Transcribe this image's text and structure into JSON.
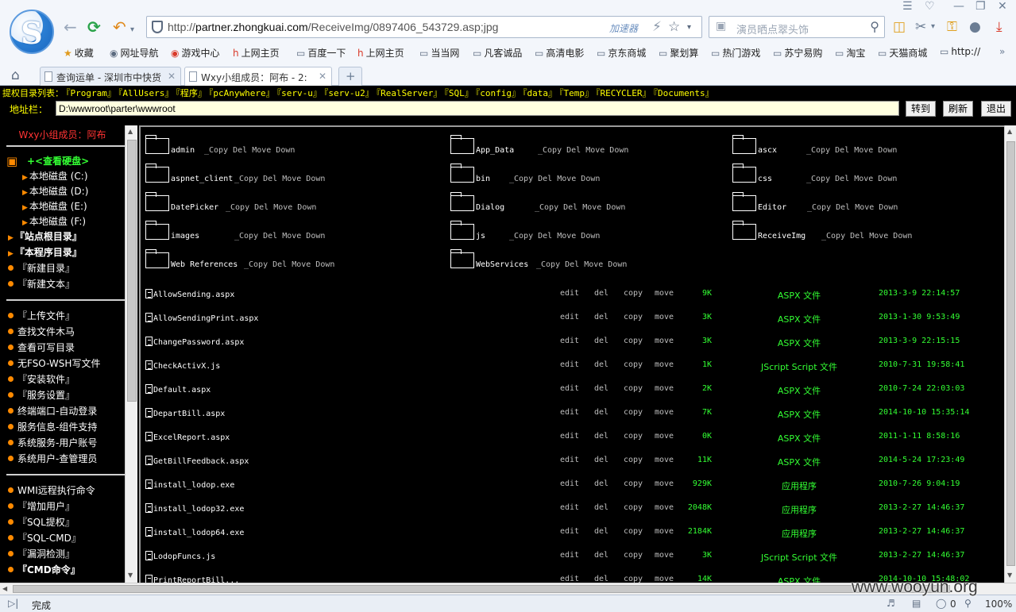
{
  "browser": {
    "logo_letter": "S",
    "url_domain": "partner.zhongkuai.com",
    "url_prefix": "http://",
    "url_path": "/ReceiveImg/0897406_543729.asp;jpg",
    "accelerator_label": "加速器",
    "search_placeholder": "演员晒点翠头饰",
    "favorites": [
      {
        "label": "收藏",
        "icon": "star-icon"
      },
      {
        "label": "网址导航",
        "icon": "globe-icon"
      },
      {
        "label": "游戏中心",
        "icon": "game-icon"
      },
      {
        "label": "上网主页",
        "icon": "hao-icon"
      },
      {
        "label": "百度一下",
        "icon": "page-icon"
      },
      {
        "label": "上网主页",
        "icon": "hao-icon"
      },
      {
        "label": "当当网",
        "icon": "page-icon"
      },
      {
        "label": "凡客诚品",
        "icon": "page-icon"
      },
      {
        "label": "高清电影",
        "icon": "page-icon"
      },
      {
        "label": "京东商城",
        "icon": "page-icon"
      },
      {
        "label": "聚划算",
        "icon": "page-icon"
      },
      {
        "label": "热门游戏",
        "icon": "page-icon"
      },
      {
        "label": "苏宁易购",
        "icon": "page-icon"
      },
      {
        "label": "淘宝",
        "icon": "page-icon"
      },
      {
        "label": "天猫商城",
        "icon": "page-icon"
      },
      {
        "label": "http://",
        "icon": "page-icon"
      }
    ],
    "tabs": [
      {
        "label": "查询运单 - 深圳市中快货",
        "active": false
      },
      {
        "label": "Wxy小组成员：阿布 - 2:",
        "active": true
      }
    ],
    "status_text": "完成",
    "blocked_count": "0",
    "zoom": "100%"
  },
  "shell": {
    "dir_list_label": "提权目录列表：",
    "dir_list": [
      "『Program』",
      "『AllUsers』",
      "『程序』",
      "『pcAnywhere』",
      "『serv-u』",
      "『serv-u2』",
      "『RealServer』",
      "『SQL』",
      "『config』",
      "『data』",
      "『Temp』",
      "『RECYCLER』",
      "『Documents』"
    ],
    "address_label": "地址栏：",
    "address_value": "D:\\wwwroot\\parter\\wwwroot",
    "goto_label": "转到",
    "refresh_label": "刷新",
    "exit_label": "退出"
  },
  "sidebar": {
    "title": "Wxy小组成员：阿布",
    "view_disks": "+<查看硬盘>",
    "disks": [
      "本地磁盘 (C:)",
      "本地磁盘 (D:)",
      "本地磁盘 (E:)",
      "本地磁盘 (F:)"
    ],
    "group1": [
      "『站点根目录』",
      "『本程序目录』",
      "『新建目录』",
      "『新建文本』"
    ],
    "group2": [
      "『上传文件』",
      "查找文件木马",
      "查看可写目录",
      "无FSO-WSH写文件",
      "『安装软件』",
      "『服务设置』",
      "终端端口-自动登录",
      "服务信息-组件支持",
      "系统服务-用户账号",
      "系统用户-查管理员"
    ],
    "group3": [
      "WMI远程执行命令",
      "『增加用户』",
      "『SQL提权』",
      "『SQL-CMD』",
      "『漏洞检测』",
      "『CMD命令』"
    ]
  },
  "folders": [
    {
      "name": "admin",
      "actions": "_Copy Del Move Down"
    },
    {
      "name": "App_Data",
      "actions": "_Copy Del Move Down"
    },
    {
      "name": "ascx",
      "actions": "_Copy Del Move Down"
    },
    {
      "name": "aspnet_client",
      "actions": "_Copy Del Move Down"
    },
    {
      "name": "bin",
      "actions": "_Copy Del Move Down"
    },
    {
      "name": "css",
      "actions": "_Copy Del Move Down"
    },
    {
      "name": "DatePicker",
      "actions": "_Copy Del Move Down"
    },
    {
      "name": "Dialog",
      "actions": "_Copy Del Move Down"
    },
    {
      "name": "Editor",
      "actions": "_Copy Del Move Down"
    },
    {
      "name": "images",
      "actions": "_Copy Del Move Down"
    },
    {
      "name": "js",
      "actions": "_Copy Del Move Down"
    },
    {
      "name": "ReceiveImg",
      "actions": "_Copy Del Move Down"
    },
    {
      "name": "Web References",
      "actions": "_Copy Del Move Down"
    },
    {
      "name": "WebServices",
      "actions": "_Copy Del Move Down"
    }
  ],
  "file_actions": [
    "edit",
    "del",
    "copy",
    "move"
  ],
  "files": [
    {
      "name": "AllowSending.aspx",
      "size": "9K",
      "type": "ASPX 文件",
      "date": "2013-3-9 22:14:57"
    },
    {
      "name": "AllowSendingPrint.aspx",
      "size": "3K",
      "type": "ASPX 文件",
      "date": "2013-1-30 9:53:49"
    },
    {
      "name": "ChangePassword.aspx",
      "size": "3K",
      "type": "ASPX 文件",
      "date": "2013-3-9 22:15:15"
    },
    {
      "name": "CheckActivX.js",
      "size": "1K",
      "type": "JScript Script 文件",
      "date": "2010-7-31 19:58:41"
    },
    {
      "name": "Default.aspx",
      "size": "2K",
      "type": "ASPX 文件",
      "date": "2010-7-24 22:03:03"
    },
    {
      "name": "DepartBill.aspx",
      "size": "7K",
      "type": "ASPX 文件",
      "date": "2014-10-10 15:35:14"
    },
    {
      "name": "ExcelReport.aspx",
      "size": "0K",
      "type": "ASPX 文件",
      "date": "2011-1-11 8:58:16"
    },
    {
      "name": "GetBillFeedback.aspx",
      "size": "11K",
      "type": "ASPX 文件",
      "date": "2014-5-24 17:23:49"
    },
    {
      "name": "install_lodop.exe",
      "size": "929K",
      "type": "应用程序",
      "date": "2010-7-26 9:04:19"
    },
    {
      "name": "install_lodop32.exe",
      "size": "2048K",
      "type": "应用程序",
      "date": "2013-2-27 14:46:37"
    },
    {
      "name": "install_lodop64.exe",
      "size": "2184K",
      "type": "应用程序",
      "date": "2013-2-27 14:46:37"
    },
    {
      "name": "LodopFuncs.js",
      "size": "3K",
      "type": "JScript Script 文件",
      "date": "2013-2-27 14:46:37"
    },
    {
      "name": "PrintReportBill...",
      "size": "14K",
      "type": "ASPX 文件",
      "date": "2014-10-10 15:48:02"
    }
  ],
  "watermark": "www.wooyun.org"
}
